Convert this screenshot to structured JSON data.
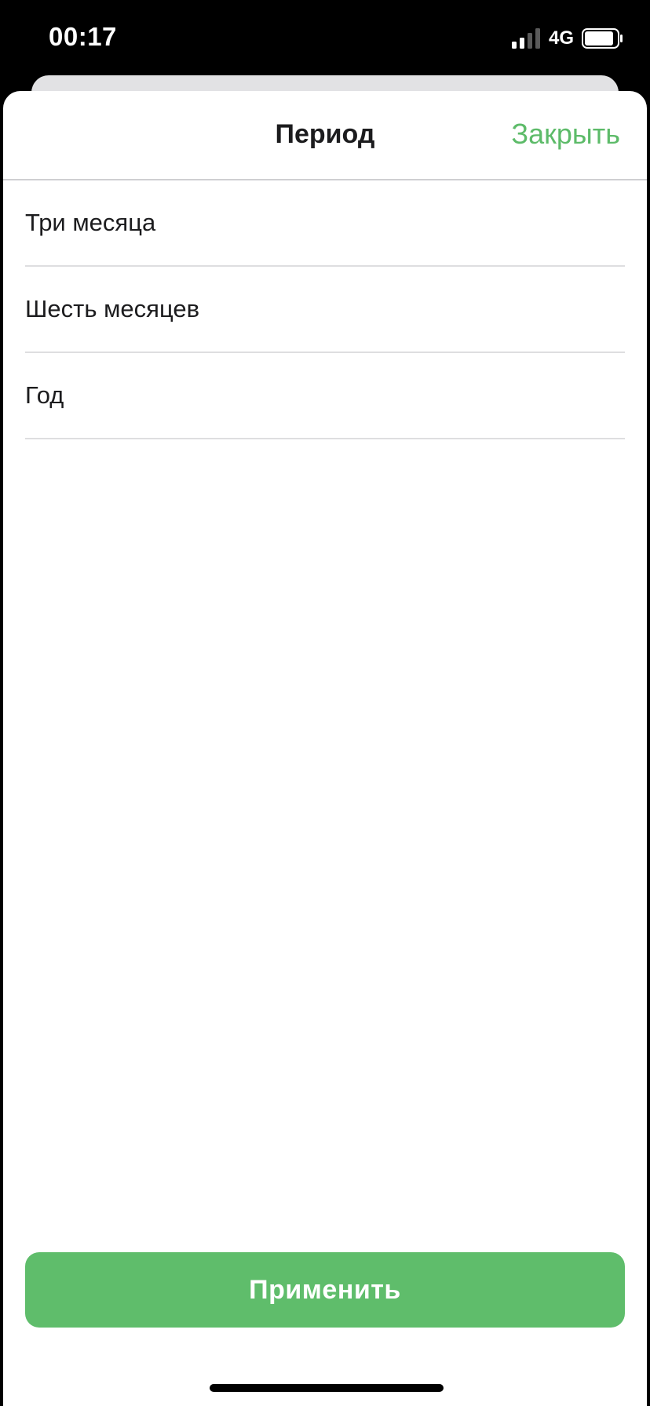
{
  "status_bar": {
    "time": "00:17",
    "network": "4G",
    "signal_icon": "signal-bars-icon",
    "battery_icon": "battery-icon"
  },
  "sheet": {
    "title": "Период",
    "close_label": "Закрыть",
    "options": [
      {
        "label": "Три месяца"
      },
      {
        "label": "Шесть месяцев"
      },
      {
        "label": "Год"
      }
    ],
    "apply_label": "Применить"
  },
  "colors": {
    "accent": "#5dbb69",
    "button_bg": "#5fbd6b",
    "background": "#ffffff",
    "status_bar_bg": "#000000"
  }
}
